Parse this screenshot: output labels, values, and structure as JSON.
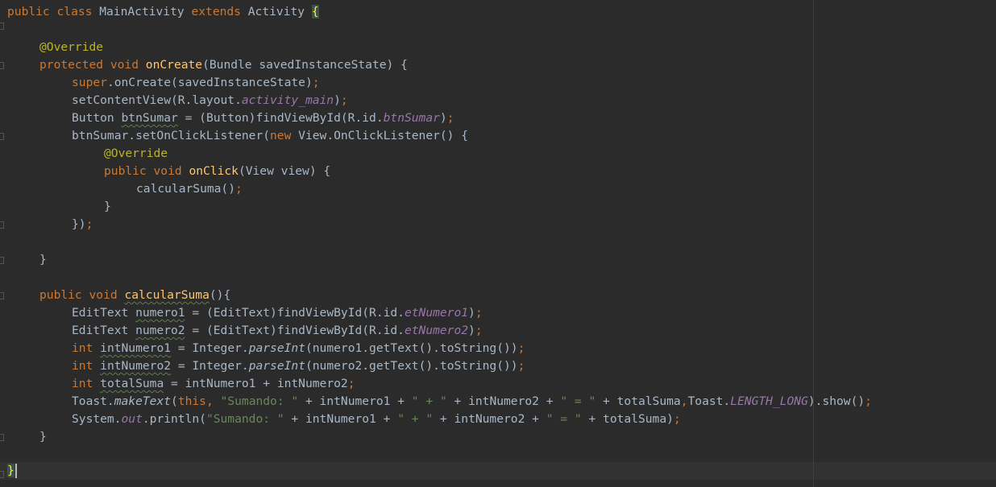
{
  "editor": {
    "theme": "darcula",
    "colors": {
      "background": "#2b2b2b",
      "keyword": "#cc7832",
      "method": "#ffc66d",
      "annotation": "#bbb529",
      "string": "#6a8759",
      "field": "#9876aa",
      "text": "#a9b7c6"
    },
    "code": {
      "l1": {
        "a": "public class ",
        "b": "MainActivity ",
        "c": "extends ",
        "d": "Activity ",
        "e": "{"
      },
      "l2": {
        "a": "@Override"
      },
      "l3": {
        "a": "protected void ",
        "b": "onCreate",
        "c": "(Bundle savedInstanceState) {"
      },
      "l4": {
        "a": "super",
        "b": ".onCreate(savedInstanceState)",
        "c": ";"
      },
      "l5": {
        "a": "setContentView(R.layout.",
        "b": "activity_main",
        "c": ")",
        "d": ";"
      },
      "l6": {
        "a": "Button ",
        "b": "btnSumar",
        "c": " = (Button)findViewById(R.id.",
        "d": "btnSumar",
        "e": ")",
        "f": ";"
      },
      "l7": {
        "a": "btnSumar.setOnClickListener(",
        "b": "new ",
        "c": "View.OnClickListener() {"
      },
      "l8": {
        "a": "@Override"
      },
      "l9": {
        "a": "public void ",
        "b": "onClick",
        "c": "(View view) {"
      },
      "l10": {
        "a": "calcularSuma()",
        "b": ";"
      },
      "l11": {
        "a": "}"
      },
      "l12": {
        "a": "})",
        "b": ";"
      },
      "l13": {
        "a": "}"
      },
      "l14": {
        "a": "public void ",
        "b": "calcularSuma",
        "c": "(){"
      },
      "l15": {
        "a": "EditText ",
        "b": "numero1",
        "c": " = (EditText)findViewById(R.id.",
        "d": "etNumero1",
        "e": ")",
        "f": ";"
      },
      "l16": {
        "a": "EditText ",
        "b": "numero2",
        "c": " = (EditText)findViewById(R.id.",
        "d": "etNumero2",
        "e": ")",
        "f": ";"
      },
      "l17": {
        "a": "int ",
        "b": "intNumero1",
        "c": " = Integer.",
        "d": "parseInt",
        "e": "(numero1.getText().toString())",
        "f": ";"
      },
      "l18": {
        "a": "int ",
        "b": "intNumero2",
        "c": " = Integer.",
        "d": "parseInt",
        "e": "(numero2.getText().toString())",
        "f": ";"
      },
      "l19": {
        "a": "int ",
        "b": "totalSuma",
        "c": " = intNumero1 + intNumero2",
        "d": ";"
      },
      "l20": {
        "a": "Toast.",
        "b": "makeText",
        "c": "(",
        "d": "this",
        "e": ", ",
        "f": "\"Sumando: \"",
        "g": " + intNumero1 + ",
        "h": "\" + \"",
        "i": " + intNumero2 + ",
        "j": "\" = \"",
        "k": " + totalSuma",
        "l": ",",
        "m": "Toast.",
        "n": "LENGTH_LONG",
        "o": ").show()",
        "p": ";"
      },
      "l21": {
        "a": "System.",
        "b": "out",
        "c": ".println(",
        "d": "\"Sumando: \"",
        "e": " + intNumero1 + ",
        "f": "\" + \"",
        "g": " + intNumero2 + ",
        "h": "\" = \"",
        "i": " + totalSuma)",
        "j": ";"
      },
      "l22": {
        "a": "}"
      },
      "l23": {
        "a": "}"
      }
    }
  }
}
